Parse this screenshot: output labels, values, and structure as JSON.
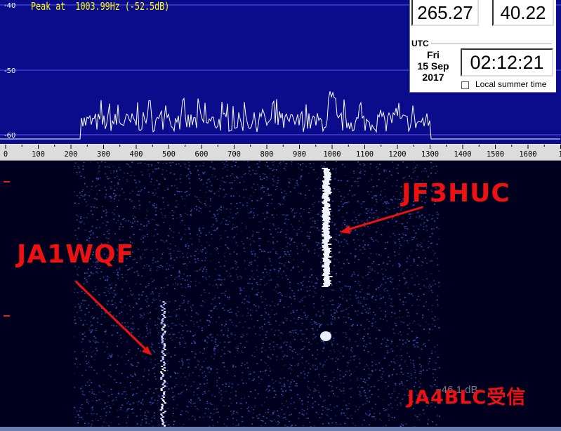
{
  "spectrum": {
    "peak_label": "Peak at  1003.99Hz (-52.5dB)",
    "db_labels": [
      "-40",
      "-50",
      "-60"
    ],
    "grid_color": "#5a5af0",
    "trace_color": "#ffffff",
    "background": "#0a0c8c"
  },
  "scale": {
    "ticks": [
      "0",
      "100",
      "200",
      "300",
      "400",
      "500",
      "600",
      "700",
      "800",
      "900",
      "1000",
      "1100",
      "1200",
      "1300",
      "1400",
      "1500",
      "1600",
      "1"
    ]
  },
  "readout": {
    "value_a": "265.27",
    "value_b": "40.22",
    "utc_label": "UTC",
    "weekday": "Fri",
    "date": "15 Sep",
    "year": "2017",
    "time": "02:12:21",
    "dst_label": "Local summer time",
    "dst_checked": false
  },
  "waterfall": {
    "overlap_label": "−46.1 dB"
  },
  "annotations": {
    "call_a": "JF3HUC",
    "call_b": "JA1WQF",
    "call_c": "JA4BLC受信",
    "color": "#ee1111"
  }
}
